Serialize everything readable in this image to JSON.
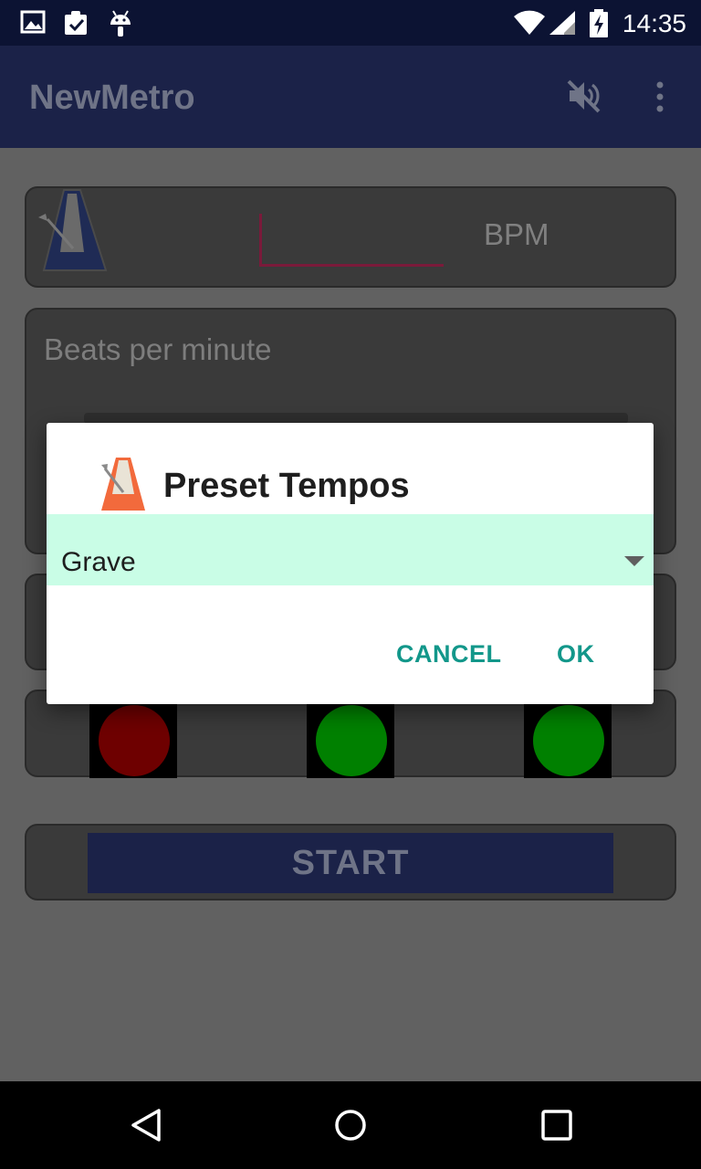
{
  "status_bar": {
    "time": "14:35",
    "icons": [
      "image-icon",
      "clipboard-check-icon",
      "android-icon",
      "wifi-icon",
      "signal-icon",
      "battery-charging-icon"
    ]
  },
  "app_bar": {
    "title": "NewMetro",
    "actions": [
      "volume-mute-icon",
      "more-vert-icon"
    ]
  },
  "main": {
    "bpm_field": {
      "value": "",
      "unit_label": "BPM"
    },
    "beats_per_minute_label": "Beats per minute",
    "lights": [
      {
        "color": "#6e0000"
      },
      {
        "color": "#008000"
      },
      {
        "color": "#008000"
      }
    ],
    "start_label": "START"
  },
  "dialog": {
    "title": "Preset Tempos",
    "selected_preset": "Grave",
    "cancel_label": "CANCEL",
    "ok_label": "OK",
    "spinner_bg": "#c9fde6",
    "accent": "#12978a"
  },
  "nav_bar": {
    "icons": [
      "back-icon",
      "home-icon",
      "recents-icon"
    ]
  }
}
